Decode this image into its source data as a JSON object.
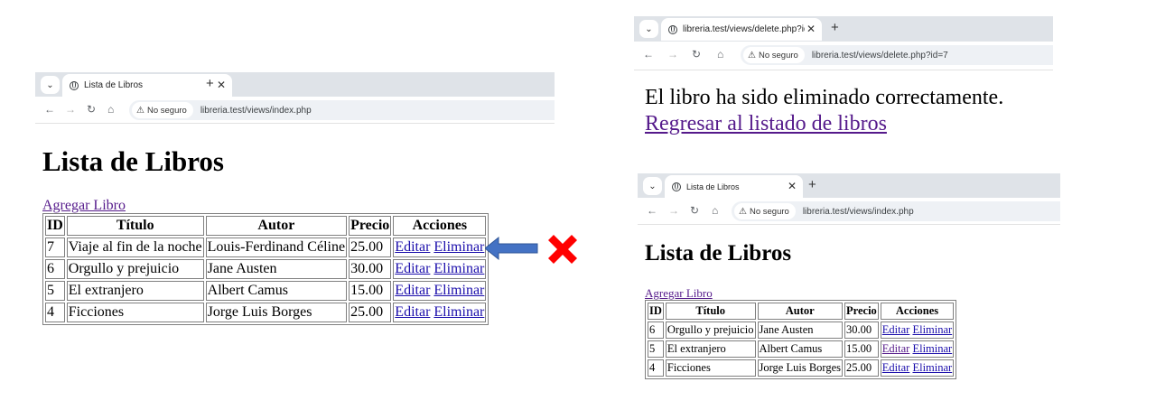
{
  "left_window": {
    "tab_title": "Lista de Libros",
    "security_label": "No seguro",
    "url": "libreria.test/views/index.php",
    "page": {
      "heading": "Lista de Libros",
      "add_link": "Agregar Libro",
      "columns": [
        "ID",
        "Título",
        "Autor",
        "Precio",
        "Acciones"
      ],
      "rows": [
        {
          "id": "7",
          "title": "Viaje al fin de la noche",
          "author": "Louis-Ferdinand Céline",
          "price": "25.00",
          "edit": "Editar",
          "delete": "Eliminar"
        },
        {
          "id": "6",
          "title": "Orgullo y prejuicio",
          "author": "Jane Austen",
          "price": "30.00",
          "edit": "Editar",
          "delete": "Eliminar"
        },
        {
          "id": "5",
          "title": "El extranjero",
          "author": "Albert Camus",
          "price": "15.00",
          "edit": "Editar",
          "delete": "Eliminar"
        },
        {
          "id": "4",
          "title": "Ficciones",
          "author": "Jorge Luis Borges",
          "price": "25.00",
          "edit": "Editar",
          "delete": "Eliminar"
        }
      ]
    }
  },
  "top_right_window": {
    "tab_title": "libreria.test/views/delete.php?id",
    "security_label": "No seguro",
    "url": "libreria.test/views/delete.php?id=7",
    "page": {
      "message": "El libro ha sido eliminado correctamente.",
      "back_link": "Regresar al listado de libros"
    }
  },
  "bottom_right_window": {
    "tab_title": "Lista de Libros",
    "security_label": "No seguro",
    "url": "libreria.test/views/index.php",
    "page": {
      "heading": "Lista de Libros",
      "add_link": "Agregar Libro",
      "columns": [
        "ID",
        "Título",
        "Autor",
        "Precio",
        "Acciones"
      ],
      "rows": [
        {
          "id": "6",
          "title": "Orgullo y prejuicio",
          "author": "Jane Austen",
          "price": "30.00",
          "edit": "Editar",
          "delete": "Eliminar"
        },
        {
          "id": "5",
          "title": "El extranjero",
          "author": "Albert Camus",
          "price": "15.00",
          "edit": "Editar",
          "delete": "Eliminar"
        },
        {
          "id": "4",
          "title": "Ficciones",
          "author": "Jorge Luis Borges",
          "price": "25.00",
          "edit": "Editar",
          "delete": "Eliminar"
        }
      ]
    }
  },
  "icons": {
    "tab_dropdown": "chevron-down-icon",
    "site": "globe-icon",
    "close": "close-icon",
    "new_tab": "plus-icon",
    "back": "arrow-left-icon",
    "forward": "arrow-right-icon",
    "reload": "reload-icon",
    "home": "home-icon",
    "not_secure": "warning-triangle-icon",
    "annotation_arrow": "arrow-left-icon",
    "annotation_cross": "cross-icon"
  },
  "colors": {
    "arrow": "#4472c4",
    "cross": "#ff0000",
    "link": "#1a0dab",
    "visited_link": "#551a8b",
    "tabstrip": "#dfe3e8"
  }
}
